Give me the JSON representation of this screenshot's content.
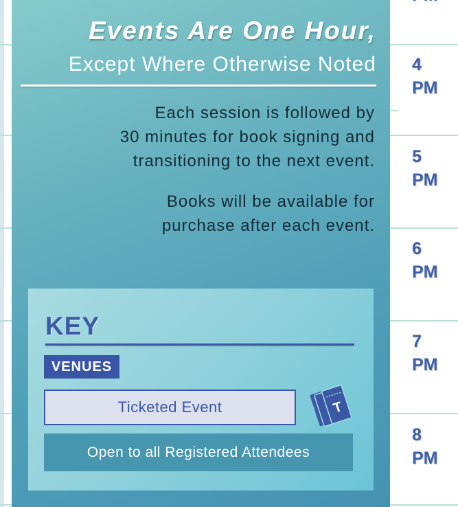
{
  "header": {
    "title": "Events Are One Hour,",
    "subtitle": "Except Where Otherwise Noted"
  },
  "info": {
    "session_note": "Each session is followed by\n30 minutes for book signing and\ntransitioning to the next event.",
    "books_note": "Books will be available for\npurchase after each event."
  },
  "key": {
    "title": "KEY",
    "venues_label": "VENUES",
    "ticketed_label": "Ticketed Event",
    "ticket_icon_letter": "T",
    "open_label": "Open to all Registered Attendees"
  },
  "schedule": {
    "times": [
      {
        "hour": "",
        "period": "PM"
      },
      {
        "hour": "4",
        "period": "PM"
      },
      {
        "hour": "5",
        "period": "PM"
      },
      {
        "hour": "6",
        "period": "PM"
      },
      {
        "hour": "7",
        "period": "PM"
      },
      {
        "hour": "8",
        "period": "PM"
      }
    ]
  },
  "colors": {
    "accent_blue": "#3b58a6",
    "panel_teal": "#4f9fb8",
    "grid_line": "#b9dfd4"
  }
}
